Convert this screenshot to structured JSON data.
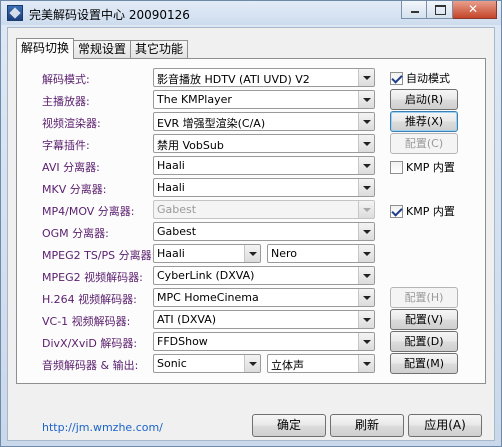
{
  "window": {
    "title": "完美解码设置中心 20090126"
  },
  "tabs": [
    "解码切换",
    "常规设置",
    "其它功能"
  ],
  "rows": [
    {
      "label": "解码模式:",
      "value": "影音播放 HDTV (ATI UVD) V2"
    },
    {
      "label": "主播放器:",
      "value": "The KMPlayer"
    },
    {
      "label": "视频渲染器:",
      "value": "EVR 增强型渲染(C/A)"
    },
    {
      "label": "字幕插件:",
      "value": "禁用 VobSub"
    },
    {
      "label": "AVI 分离器:",
      "value": "Haali"
    },
    {
      "label": "MKV 分离器:",
      "value": "Haali"
    },
    {
      "label": "MP4/MOV 分离器:",
      "value": "Gabest"
    },
    {
      "label": "OGM 分离器:",
      "value": "Gabest"
    },
    {
      "label": "MPEG2 TS/PS 分离器:",
      "value": "Haali",
      "value2": "Nero"
    },
    {
      "label": "MPEG2 视频解码器:",
      "value": "CyberLink (DXVA)"
    },
    {
      "label": "H.264 视频解码器:",
      "value": "MPC HomeCinema"
    },
    {
      "label": "VC-1 视频解码器:",
      "value": "ATI (DXVA)"
    },
    {
      "label": "DivX/XviD 解码器:",
      "value": "FFDShow"
    },
    {
      "label": "音频解码器 & 输出:",
      "value": "Sonic",
      "value2": "立体声"
    }
  ],
  "side": {
    "auto_mode": "自动模式",
    "launch": "启动(R)",
    "recommend": "推荐(X)",
    "config_c": "配置(C)",
    "kmp_builtin_1": "KMP 内置",
    "kmp_builtin_2": "KMP 内置",
    "config_h": "配置(H)",
    "config_v": "配置(V)",
    "config_d": "配置(D)",
    "config_m": "配置(M)"
  },
  "footer": {
    "link": "http://jm.wmzhe.com/",
    "ok": "确定",
    "refresh": "刷新",
    "apply": "应用(A)"
  },
  "checks": {
    "auto_mode": true,
    "kmp_avi": false,
    "kmp_mp4": true
  }
}
